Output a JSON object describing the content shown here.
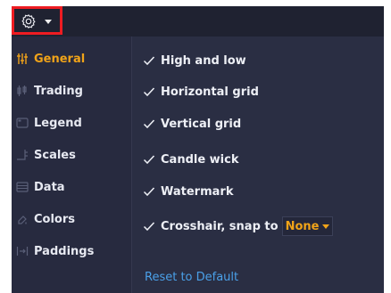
{
  "toolbar": {
    "settings_icon": "gear-icon",
    "dropdown_icon": "caret-down-icon"
  },
  "sidebar": {
    "items": [
      {
        "label": "General",
        "icon": "sliders-icon",
        "active": true
      },
      {
        "label": "Trading",
        "icon": "trading-icon",
        "active": false
      },
      {
        "label": "Legend",
        "icon": "legend-icon",
        "active": false
      },
      {
        "label": "Scales",
        "icon": "scales-icon",
        "active": false
      },
      {
        "label": "Data",
        "icon": "data-icon",
        "active": false
      },
      {
        "label": "Colors",
        "icon": "colors-icon",
        "active": false
      },
      {
        "label": "Paddings",
        "icon": "paddings-icon",
        "active": false
      }
    ]
  },
  "general": {
    "options": [
      {
        "label": "High and low",
        "checked": true
      },
      {
        "label": "Horizontal grid",
        "checked": true
      },
      {
        "label": "Vertical grid",
        "checked": true
      },
      {
        "label": "Candle wick",
        "checked": true
      },
      {
        "label": "Watermark",
        "checked": true
      },
      {
        "label": "Crosshair, snap to",
        "checked": true
      }
    ],
    "snap_value": "None",
    "reset_label": "Reset to Default"
  },
  "colors": {
    "accent": "#f0a319",
    "link": "#4aa0e8",
    "highlight_border": "#ee1c22",
    "panel": "#2a2e43"
  }
}
